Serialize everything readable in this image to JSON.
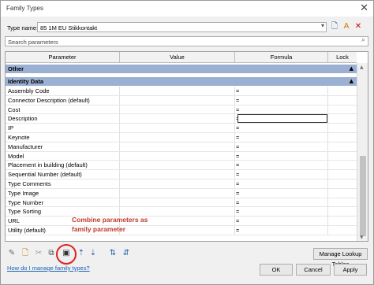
{
  "window": {
    "title": "Family Types"
  },
  "type_name": {
    "label": "Type name:",
    "value": "85 1M EU Stikkontakt"
  },
  "search": {
    "placeholder": "Search parameters"
  },
  "columns": [
    "Parameter",
    "Value",
    "Formula",
    "Lock"
  ],
  "groups": [
    {
      "name": "Other",
      "toggle": "▲"
    },
    {
      "name": "Identity Data",
      "toggle": "▲"
    }
  ],
  "rows": [
    {
      "parameter": "Assembly Code",
      "formula": "="
    },
    {
      "parameter": "Connector Description (default)",
      "formula": "="
    },
    {
      "parameter": "Cost",
      "formula": "="
    },
    {
      "parameter": "Description",
      "formula": "="
    },
    {
      "parameter": "IP",
      "formula": "="
    },
    {
      "parameter": "Keynote",
      "formula": "="
    },
    {
      "parameter": "Manufacturer",
      "formula": "="
    },
    {
      "parameter": "Model",
      "formula": "="
    },
    {
      "parameter": "Placement in building (default)",
      "formula": "="
    },
    {
      "parameter": "Sequential Number (default)",
      "formula": "="
    },
    {
      "parameter": "Type Comments",
      "formula": "="
    },
    {
      "parameter": "Type Image",
      "formula": "="
    },
    {
      "parameter": "Type Number",
      "formula": "="
    },
    {
      "parameter": "Type Sorting",
      "formula": "="
    },
    {
      "parameter": "URL",
      "formula": "="
    },
    {
      "parameter": "Utility (default)",
      "formula": "="
    }
  ],
  "annotation": {
    "line1": "Combine parameters as",
    "line2": "family parameter"
  },
  "buttons": {
    "manage_lookup": "Manage Lookup Tables",
    "ok": "OK",
    "cancel": "Cancel",
    "apply": "Apply"
  },
  "help_link": "How do I manage family types?",
  "colors": {
    "group_band": "#9cb0d3",
    "annotation": "#c0392b"
  }
}
